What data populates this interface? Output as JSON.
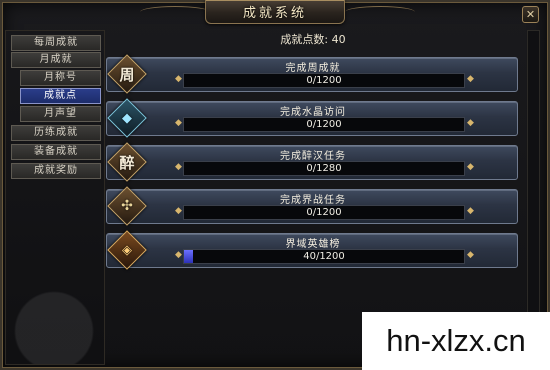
{
  "window": {
    "title": "成就系统",
    "close_icon": "close-icon"
  },
  "sidebar": {
    "items": [
      {
        "label": "每周成就",
        "selected": false
      },
      {
        "label": "月成就",
        "selected": false
      },
      {
        "label": "月称号",
        "selected": false
      },
      {
        "label": "成就点",
        "selected": true
      },
      {
        "label": "月声望",
        "selected": false
      },
      {
        "label": "历练成就",
        "selected": false
      },
      {
        "label": "装备成就",
        "selected": false
      },
      {
        "label": "成就奖励",
        "selected": false
      }
    ]
  },
  "main": {
    "points_text": "成就点数: 40",
    "rows": [
      {
        "title": "完成周成就",
        "progress_text": "0/1200",
        "current": 0,
        "total": 1200,
        "icon": "week-emblem-icon",
        "icon_glyph": "周"
      },
      {
        "title": "完成水晶访问",
        "progress_text": "0/1200",
        "current": 0,
        "total": 1200,
        "icon": "crystal-icon",
        "icon_glyph": ""
      },
      {
        "title": "完成醉汉任务",
        "progress_text": "0/1280",
        "current": 0,
        "total": 1280,
        "icon": "drunkard-emblem-icon",
        "icon_glyph": "醉"
      },
      {
        "title": "完成界战任务",
        "progress_text": "0/1200",
        "current": 0,
        "total": 1200,
        "icon": "battle-emblem-icon",
        "icon_glyph": ""
      },
      {
        "title": "界域英雄榜",
        "progress_text": "40/1200",
        "current": 40,
        "total": 1200,
        "icon": "hero-ranking-icon",
        "icon_glyph": ""
      }
    ]
  },
  "watermark": "hn-xlzx.cn",
  "colors": {
    "selected_tab": "#23348a",
    "progress_fill": "#4b50e0",
    "row_background": "#2f3848",
    "gold_trim": "#8a7450"
  }
}
